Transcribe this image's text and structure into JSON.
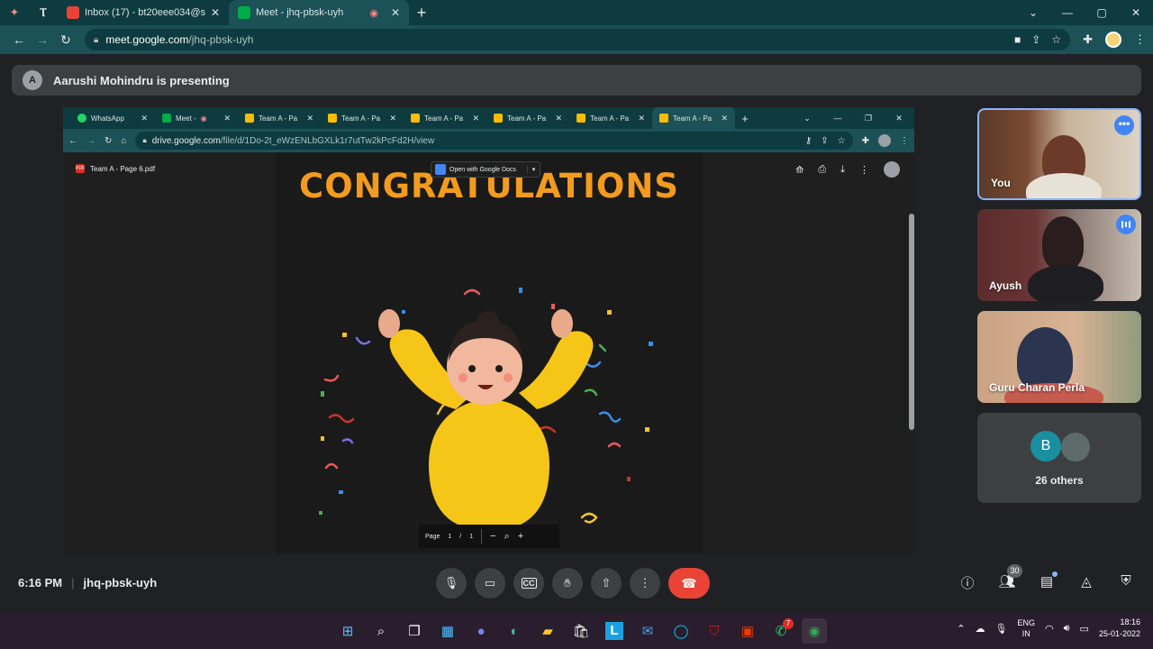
{
  "browser": {
    "tabs": [
      {
        "label": "Inbox (17) - bt20eee034@studen",
        "color": "#ea4335"
      },
      {
        "label": "Meet - jhq-pbsk-uyh",
        "color": "#00ac47",
        "active": true
      }
    ],
    "url_domain": "meet.google.com",
    "url_path": "/jhq-pbsk-uyh"
  },
  "meet": {
    "presenter_text": "Aarushi Mohindru is presenting",
    "time": "6:16 PM",
    "meeting_code": "jhq-pbsk-uyh",
    "participant_count": "30",
    "tiles": {
      "you": "You",
      "ayush": "Ayush",
      "guru": "Guru Charan Perla",
      "others_initial": "B",
      "others_label": "26 others"
    }
  },
  "shared": {
    "tabs": [
      "WhatsApp",
      "Meet -",
      "Team A - Pa",
      "Team A - Pa",
      "Team A - Pa",
      "Team A - Pa",
      "Team A - Pa",
      "Team A - Pa"
    ],
    "url_domain": "drive.google.com",
    "url_path": "/file/d/1Do-2t_eWzENLbGXLk1r7utTw2kPcFd2H/view",
    "pdf_name": "Team A - Page 6.pdf",
    "open_with": "Open with Google Docs",
    "heading": "CONGRATULATIONS",
    "page_label": "Page",
    "page_current": "1",
    "page_sep": "/",
    "page_total": "1"
  },
  "taskbar": {
    "whatsapp_badge": "7",
    "lang_line1": "ENG",
    "lang_line2": "IN",
    "clock_time": "18:16",
    "clock_date": "25-01-2022"
  },
  "colors": {
    "accent_blue": "#8ab4f8",
    "end_call": "#ea4335",
    "heading_orange": "#f39b1e",
    "chrome_teal": "#1b5157"
  }
}
